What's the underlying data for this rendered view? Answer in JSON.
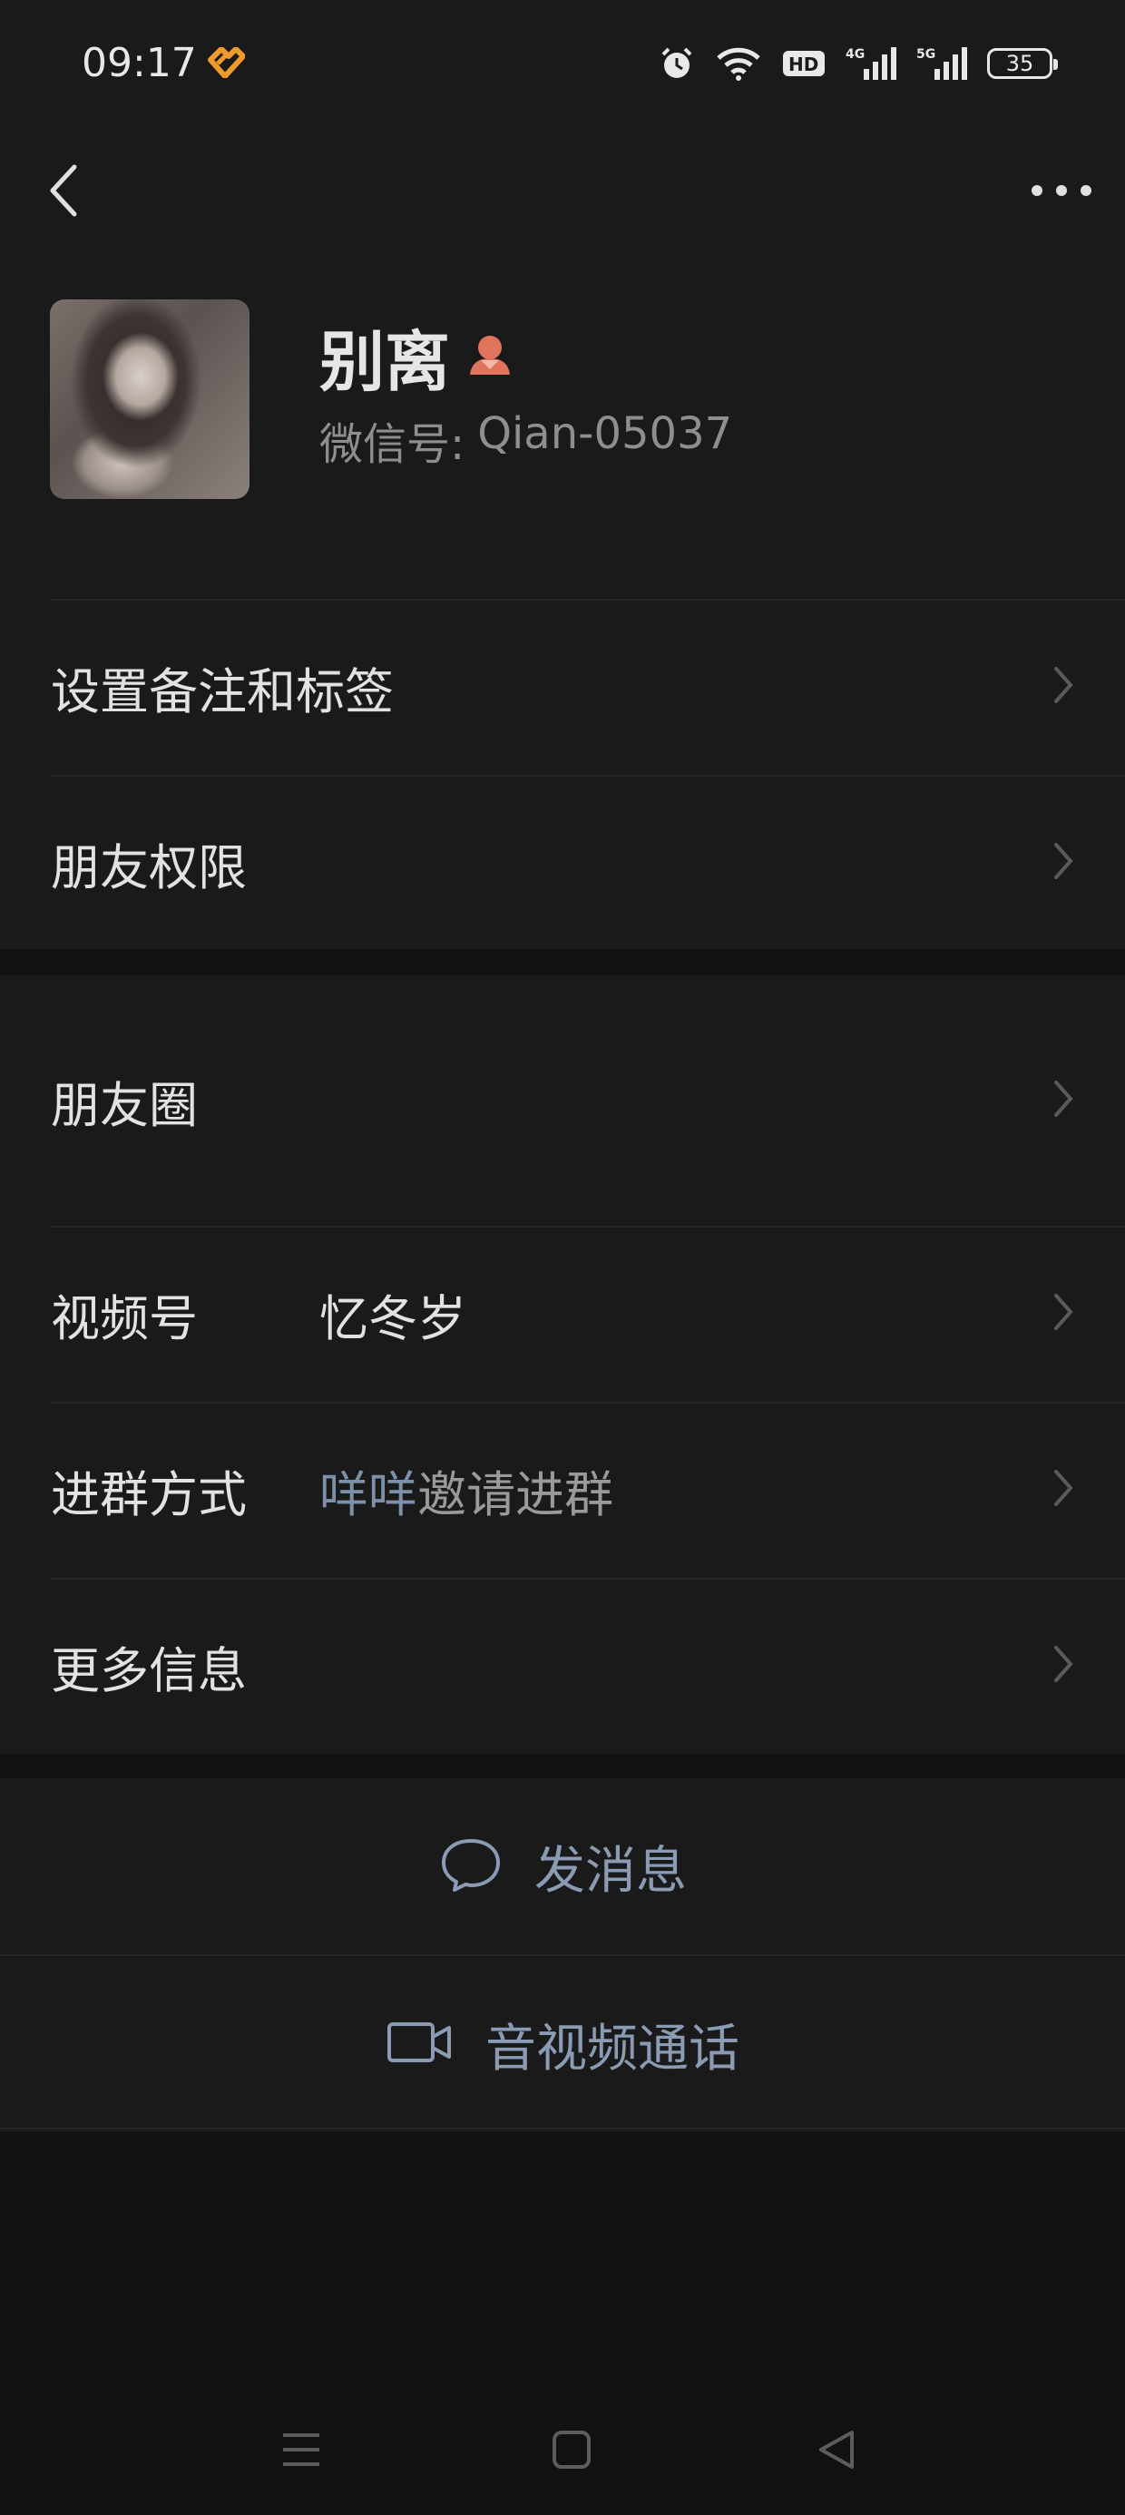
{
  "status_bar": {
    "time": "09:17",
    "network_1": "4G",
    "network_2": "5G",
    "hd_label": "HD",
    "battery": "35"
  },
  "nav": {
    "back_icon": "chevron-left-icon",
    "more_icon": "more-dots-icon"
  },
  "profile": {
    "name": "别离",
    "id_label": "微信号:",
    "id_value": "Qian-05037"
  },
  "group1": [
    {
      "label": "设置备注和标签"
    },
    {
      "label": "朋友权限"
    }
  ],
  "group2": {
    "moments": {
      "label": "朋友圈"
    },
    "channels": {
      "label": "视频号",
      "value": "忆冬岁"
    },
    "join_method": {
      "label": "进群方式",
      "value_link": "咩咩",
      "value_rest": "邀请进群"
    },
    "more_info": {
      "label": "更多信息"
    }
  },
  "actions": {
    "message": "发消息",
    "call": "音视频通话"
  },
  "colors": {
    "background": "#111111",
    "card": "#1a1a1a",
    "link": "#7d90a9",
    "gender_icon": "#e0735c"
  }
}
